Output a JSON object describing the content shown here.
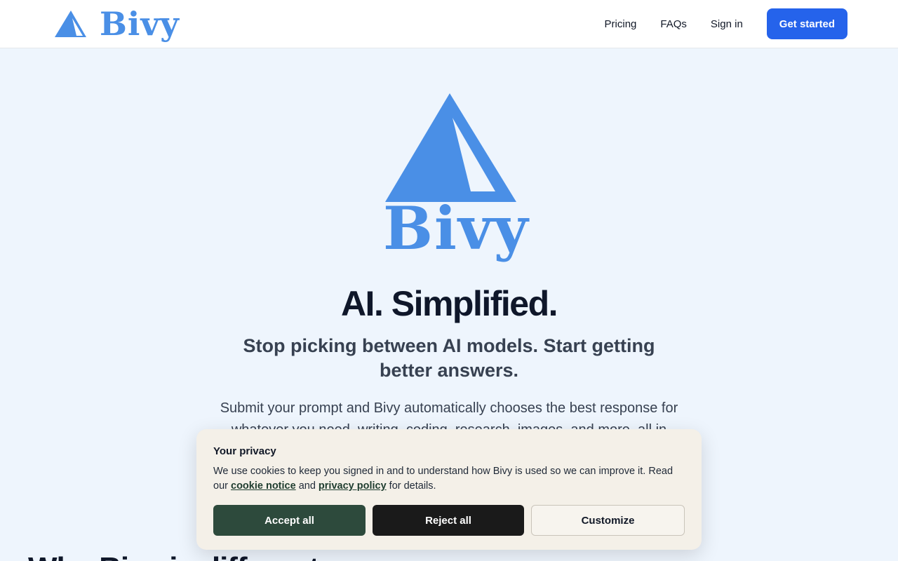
{
  "colors": {
    "brand": "#4a8fe6",
    "cta": "#2563eb",
    "accept": "#2d4a3c",
    "reject": "#1a1a1a",
    "banner": "#f4f0e8"
  },
  "header": {
    "logo_icon": "tent-logo-icon",
    "logo_text": "Bivy",
    "nav": {
      "pricing": "Pricing",
      "faqs": "FAQs",
      "sign_in": "Sign in",
      "get_started": "Get started"
    }
  },
  "hero": {
    "logo_text": "Bivy",
    "headline": "AI. Simplified.",
    "subheadline": "Stop picking between AI models. Start getting better answers.",
    "description": "Submit your prompt and Bivy automatically chooses the best response for whatever you need, writing, coding, research, images, and more, all in"
  },
  "section": {
    "title": "Why Bivy is different"
  },
  "cookie": {
    "title": "Your privacy",
    "text_before": "We use cookies to keep you signed in and to understand how Bivy is used so we can improve it. Read our ",
    "cookie_notice": "cookie notice",
    "and": " and ",
    "privacy_policy": "privacy policy",
    "text_after": " for details.",
    "accept": "Accept all",
    "reject": "Reject all",
    "customize": "Customize"
  }
}
